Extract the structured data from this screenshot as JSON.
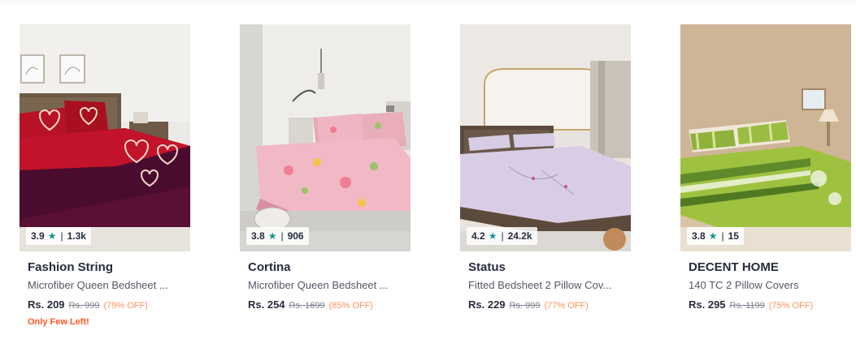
{
  "products": [
    {
      "brand": "Fashion String",
      "title": "Microfiber Queen Bedsheet ...",
      "rating": "3.9",
      "rating_count": "1.3k",
      "price": "Rs. 209",
      "mrp": "Rs. 999",
      "discount": "(79% OFF)",
      "stock_note": "Only Few Left!",
      "image_icon": "bedsheet-red-hearts-image"
    },
    {
      "brand": "Cortina",
      "title": "Microfiber Queen Bedsheet ...",
      "rating": "3.8",
      "rating_count": "906",
      "price": "Rs. 254",
      "mrp": "Rs. 1699",
      "discount": "(85% OFF)",
      "image_icon": "bedsheet-pink-floral-image"
    },
    {
      "brand": "Status",
      "title": "Fitted Bedsheet 2 Pillow Cov...",
      "rating": "4.2",
      "rating_count": "24.2k",
      "price": "Rs. 229",
      "mrp": "Rs. 999",
      "discount": "(77% OFF)",
      "image_icon": "bedsheet-lavender-image"
    },
    {
      "brand": "DECENT HOME",
      "title": "140 TC 2 Pillow Covers",
      "rating": "3.8",
      "rating_count": "15",
      "price": "Rs. 295",
      "mrp": "Rs. 1199",
      "discount": "(75% OFF)",
      "image_icon": "bedsheet-green-stripes-image"
    }
  ],
  "rating_star": "★",
  "rating_separator": "|",
  "colors": {
    "star": "#14958f",
    "discount": "#ff905a",
    "few_left": "#ff5722",
    "text_primary": "#282c3f",
    "text_secondary": "#535766"
  }
}
